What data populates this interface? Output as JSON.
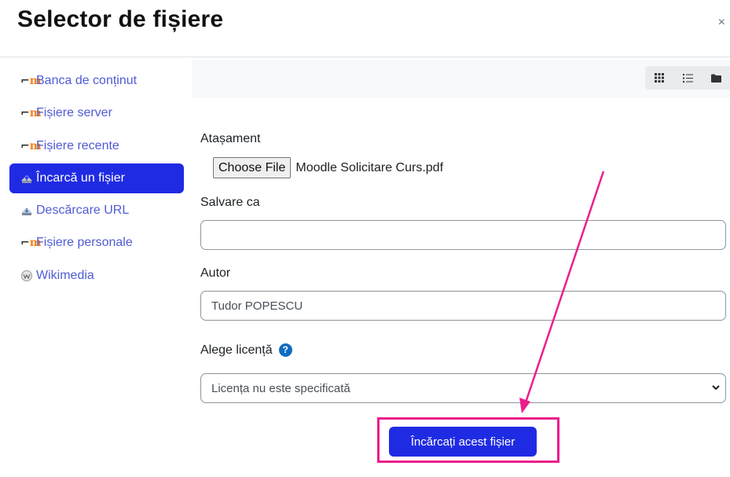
{
  "dialog": {
    "title": "Selector de fișiere",
    "close_label": "×"
  },
  "sidebar": {
    "items": [
      {
        "label": "Banca de conținut",
        "icon": "moodle-icon",
        "active": false
      },
      {
        "label": "Fișiere server",
        "icon": "moodle-icon",
        "active": false
      },
      {
        "label": "Fișiere recente",
        "icon": "moodle-icon",
        "active": false
      },
      {
        "label": "Încarcă un fișier",
        "icon": "upload-icon",
        "active": true
      },
      {
        "label": "Descărcare URL",
        "icon": "download-url-icon",
        "active": false
      },
      {
        "label": "Fișiere personale",
        "icon": "moodle-icon",
        "active": false
      },
      {
        "label": "Wikimedia",
        "icon": "wikimedia-icon",
        "active": false
      }
    ]
  },
  "toolbar": {
    "views": [
      "grid-view-icon",
      "list-view-icon",
      "folder-view-icon"
    ]
  },
  "form": {
    "attachment_label": "Atașament",
    "choose_file_label": "Choose File",
    "selected_file": "Moodle Solicitare Curs.pdf",
    "save_as_label": "Salvare ca",
    "save_as_value": "",
    "author_label": "Autor",
    "author_value": "Tudor POPESCU",
    "license_label": "Alege licență",
    "license_value": "Licența nu este specificată",
    "submit_label": "Încărcați acest fișier"
  },
  "colors": {
    "accent": "#1f2be3",
    "link": "#4f5bd5",
    "annotation": "#ec1e8c",
    "moodle_orange": "#f98012"
  }
}
